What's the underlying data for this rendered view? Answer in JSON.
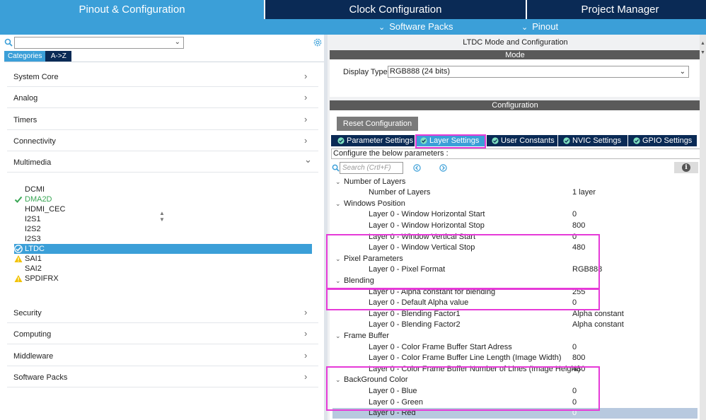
{
  "top_tabs": {
    "pinout": "Pinout & Configuration",
    "clock": "Clock Configuration",
    "project": "Project Manager"
  },
  "sub_links": {
    "software_packs": "Software Packs",
    "pinout": "Pinout"
  },
  "left": {
    "search_value": "",
    "tabs": {
      "categories": "Categories",
      "az": "A->Z"
    },
    "categories_top": [
      "System Core",
      "Analog",
      "Timers",
      "Connectivity",
      "Multimedia"
    ],
    "peripherals": [
      {
        "label": "DCMI",
        "status": "none"
      },
      {
        "label": "DMA2D",
        "status": "ok"
      },
      {
        "label": "HDMI_CEC",
        "status": "none"
      },
      {
        "label": "I2S1",
        "status": "none"
      },
      {
        "label": "I2S2",
        "status": "none"
      },
      {
        "label": "I2S3",
        "status": "none"
      },
      {
        "label": "LTDC",
        "status": "ok-selected"
      },
      {
        "label": "SAI1",
        "status": "warn"
      },
      {
        "label": "SAI2",
        "status": "none"
      },
      {
        "label": "SPDIFRX",
        "status": "warn"
      }
    ],
    "categories_bottom": [
      "Security",
      "Computing",
      "Middleware",
      "Software Packs"
    ]
  },
  "right": {
    "title": "LTDC Mode and Configuration",
    "mode_header": "Mode",
    "display_type_label": "Display Type",
    "display_type_value": "RGB888 (24 bits)",
    "config_header": "Configuration",
    "reset_button": "Reset Configuration",
    "tabs": [
      "Parameter Settings",
      "Layer Settings",
      "User Constants",
      "NVIC Settings",
      "GPIO Settings"
    ],
    "selected_tab": "Layer Settings",
    "configure_text": "Configure the below parameters :",
    "search_placeholder": "Search (Crtl+F)",
    "groups": [
      {
        "name": "Number of Layers",
        "params": [
          {
            "name": "Number of Layers",
            "value": "1 layer"
          }
        ]
      },
      {
        "name": "Windows Position",
        "params": [
          {
            "name": "Layer 0 - Window Horizontal Start",
            "value": "0"
          },
          {
            "name": "Layer 0 - Window Horizontal Stop",
            "value": "800"
          },
          {
            "name": "Layer 0 - Window Vertical Start",
            "value": "0"
          },
          {
            "name": "Layer 0 - Window Vertical Stop",
            "value": "480"
          }
        ]
      },
      {
        "name": "Pixel Parameters",
        "params": [
          {
            "name": "Layer 0 - Pixel Format",
            "value": "RGB888"
          }
        ]
      },
      {
        "name": "Blending",
        "params": [
          {
            "name": "Layer 0 - Alpha constant for blending",
            "value": "255"
          },
          {
            "name": "Layer 0 - Default Alpha value",
            "value": "0"
          },
          {
            "name": "Layer 0 - Blending Factor1",
            "value": "Alpha constant"
          },
          {
            "name": "Layer 0 - Blending Factor2",
            "value": "Alpha constant"
          }
        ]
      },
      {
        "name": "Frame Buffer",
        "params": [
          {
            "name": "Layer 0 - Color Frame Buffer Start Adress",
            "value": "0"
          },
          {
            "name": "Layer 0 - Color Frame Buffer Line Length (Image Width)",
            "value": "800"
          },
          {
            "name": "Layer 0 - Color Frame Buffer Number of Lines (Image Height)",
            "value": "480"
          }
        ]
      },
      {
        "name": "BackGround Color",
        "params": [
          {
            "name": "Layer 0 - Blue",
            "value": "0"
          },
          {
            "name": "Layer 0 - Green",
            "value": "0"
          },
          {
            "name": "Layer 0 - Red",
            "value": "0"
          }
        ]
      }
    ]
  },
  "colors": {
    "accent": "#3b9fd8",
    "navy": "#0a2a55",
    "highlight": "#e63ad8",
    "ok_green": "#3aa655",
    "warn_yellow": "#f2c200"
  },
  "icons": [
    "search-icon",
    "gear-icon",
    "chevron-right-icon",
    "chevron-down-icon",
    "check-circle-icon",
    "warning-icon",
    "info-icon",
    "prev-icon",
    "next-icon"
  ]
}
